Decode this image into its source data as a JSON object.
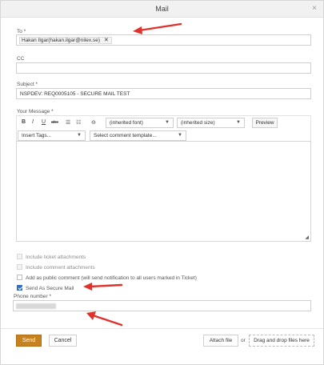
{
  "dialog": {
    "title": "Mail",
    "close_symbol": "×"
  },
  "to": {
    "label": "To *",
    "recipient": "Hakan Ilgar(hakan.ilgar@nilex.se)",
    "remove_symbol": "✕"
  },
  "cc": {
    "label": "CC",
    "value": ""
  },
  "subject": {
    "label": "Subject *",
    "value": "NSPDEV: REQ0005105 - SECURE MAIL TEST"
  },
  "message": {
    "label": "Your Message *",
    "toolbar": {
      "bold": "B",
      "italic": "I",
      "underline": "U",
      "strike": "abc",
      "bullets": "☰",
      "numbers": "☷",
      "link": "⊖",
      "font": "(inherited font)",
      "size": "(inherited size)",
      "preview": "Preview",
      "insert_tags": "Insert Tags...",
      "comment_template": "Select comment template..."
    },
    "body": ""
  },
  "options": [
    {
      "label": "Include ticket attachments",
      "checked": false,
      "disabled": true
    },
    {
      "label": "Include comment attachments",
      "checked": false,
      "disabled": true
    },
    {
      "label": "Add as public comment (will send notification to all users marked in Ticket)",
      "checked": false,
      "disabled": false
    },
    {
      "label": "Send As Secure Mail",
      "checked": true,
      "disabled": false
    }
  ],
  "phone": {
    "label": "Phone number *"
  },
  "footer": {
    "send": "Send",
    "cancel": "Cancel",
    "attach": "Attach file",
    "or": "or",
    "drop": "Drag and drop files here"
  },
  "colors": {
    "send_button": "#c8811f",
    "annotation_arrow": "#e0322b",
    "checkbox_checked": "#2f6fbf"
  }
}
